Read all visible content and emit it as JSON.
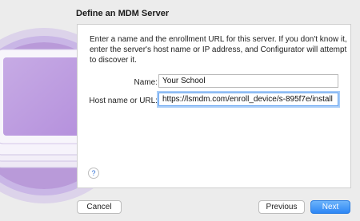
{
  "dialog": {
    "title": "Define an MDM Server",
    "description": "Enter a name and the enrollment URL for this server. If you don't know it, enter the server's host name or IP address, and Configurator will attempt to discover it.",
    "name_label": "Name:",
    "name_value": "Your School",
    "host_label": "Host name or URL:",
    "host_value": "https://lsmdm.com/enroll_device/s-895f7e/install",
    "help": "?"
  },
  "footer": {
    "cancel": "Cancel",
    "previous": "Previous",
    "next": "Next"
  },
  "icons": {
    "illustration": "ipad-stack-icon"
  }
}
